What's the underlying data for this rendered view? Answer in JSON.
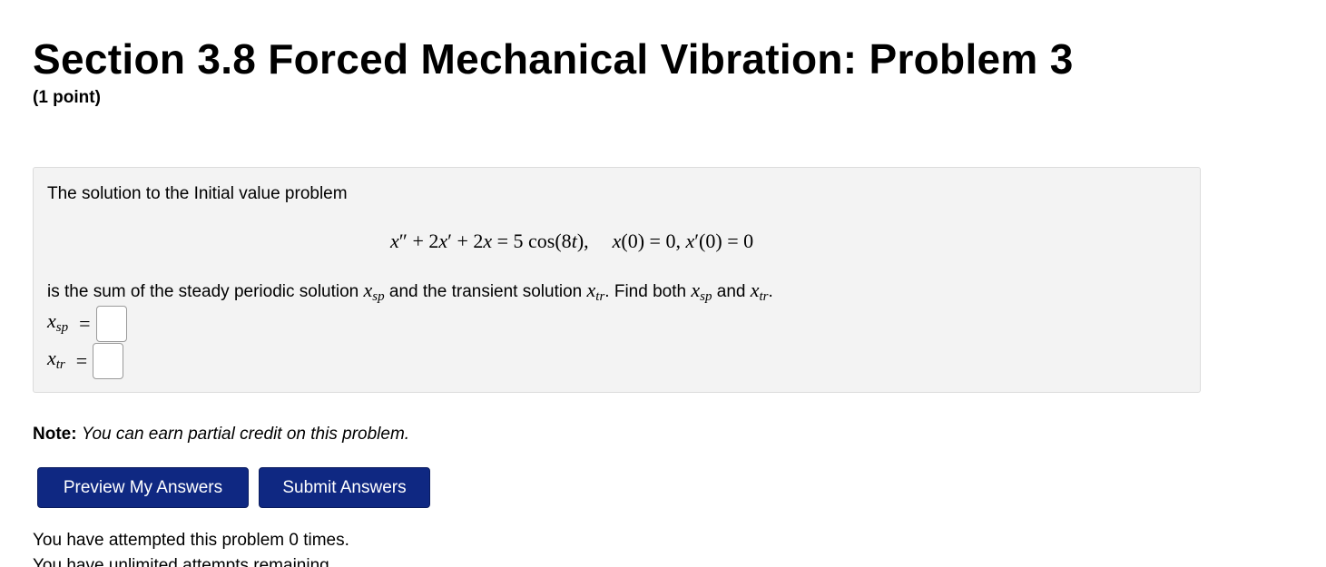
{
  "header": {
    "title": "Section 3.8 Forced Mechanical Vibration: Problem 3",
    "points": "(1 point)"
  },
  "problem": {
    "intro": "The solution to the Initial value problem",
    "equation": {
      "xpp": "x",
      "xpp_prime": "″",
      "plus1": " + 2",
      "xp": "x",
      "xp_prime": "′",
      "plus2": " + 2",
      "x": "x",
      "eq1": " = 5 cos(8",
      "t": "t",
      "close": "),",
      "ic1_x": "x",
      "ic1_rest": "(0) = 0, ",
      "ic2_x": "x",
      "ic2_rest": "′(0) = 0"
    },
    "sentence": {
      "part1": "is the sum of the steady periodic solution ",
      "part2": " and the transient solution ",
      "part3": ". Find both ",
      "part4": " and ",
      "part5": "."
    },
    "var_x": "x",
    "sub_sp": "sp",
    "sub_tr": "tr",
    "equals": "=",
    "answers": {
      "xsp_value": "",
      "xtr_value": ""
    }
  },
  "note": {
    "label": "Note:",
    "text": "You can earn partial credit on this problem."
  },
  "buttons": {
    "preview": "Preview My Answers",
    "submit": "Submit Answers"
  },
  "status": {
    "attempts": "You have attempted this problem 0 times.",
    "remaining": "You have unlimited attempts remaining."
  },
  "colors": {
    "button_bg": "#0f2882",
    "box_bg": "#f3f3f3"
  }
}
